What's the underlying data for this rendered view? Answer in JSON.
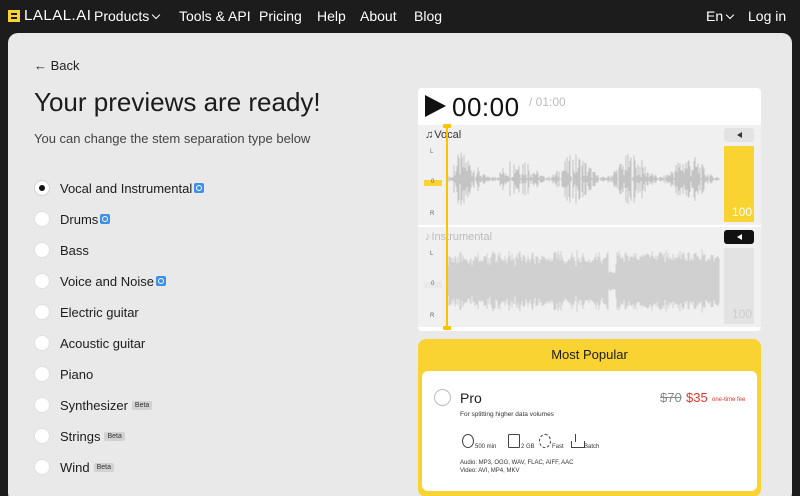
{
  "nav": {
    "logo": "LALAL.AI",
    "items": [
      "Products",
      "Tools & API",
      "Pricing",
      "Help",
      "About",
      "Blog"
    ],
    "language": "En",
    "login": "Log in"
  },
  "page": {
    "back": "← Back",
    "title": "Your previews are ready!",
    "subtitle": "You can change the stem separation type below"
  },
  "stems": [
    {
      "label": "Vocal and Instrumental",
      "checked": true,
      "badge": "pro"
    },
    {
      "label": "Drums",
      "checked": false,
      "badge": "pro"
    },
    {
      "label": "Bass",
      "checked": false,
      "badge": ""
    },
    {
      "label": "Voice and Noise",
      "checked": false,
      "badge": "pro"
    },
    {
      "label": "Electric guitar",
      "checked": false,
      "badge": ""
    },
    {
      "label": "Acoustic guitar",
      "checked": false,
      "badge": ""
    },
    {
      "label": "Piano",
      "checked": false,
      "badge": ""
    },
    {
      "label": "Synthesizer",
      "checked": false,
      "badge": "Beta"
    },
    {
      "label": "Strings",
      "checked": false,
      "badge": "Beta"
    },
    {
      "label": "Wind",
      "checked": false,
      "badge": "Beta"
    }
  ],
  "player": {
    "current_time": "00:00",
    "total_time": "/ 01:00",
    "tracks": [
      {
        "name": "Vocal",
        "volume": "100",
        "channel_left": "L",
        "channel_mid": "0",
        "channel_right": "R",
        "muted": false
      },
      {
        "name": "Instrumental",
        "volume": "100",
        "channel_left": "L",
        "channel_mid": "0",
        "channel_right": "R",
        "muted": true
      }
    ]
  },
  "pricing": {
    "header": "Most Popular",
    "plan": "Pro",
    "description": "For splitting higher data volumes",
    "old_price": "$70",
    "new_price": "$35",
    "price_note": "one-time fee",
    "features": [
      "500 min",
      "2 GB",
      "Fast",
      "Batch"
    ],
    "audio_formats": "Audio: MP3, OGG, WAV, FLAC, AIFF, AAC",
    "video_formats": "Video: AVI, MP4, MKV"
  },
  "colors": {
    "accent": "#f9d331",
    "dark": "#1c1c1c",
    "price_red": "#e3352b",
    "pro_badge": "#3d8fe8"
  }
}
